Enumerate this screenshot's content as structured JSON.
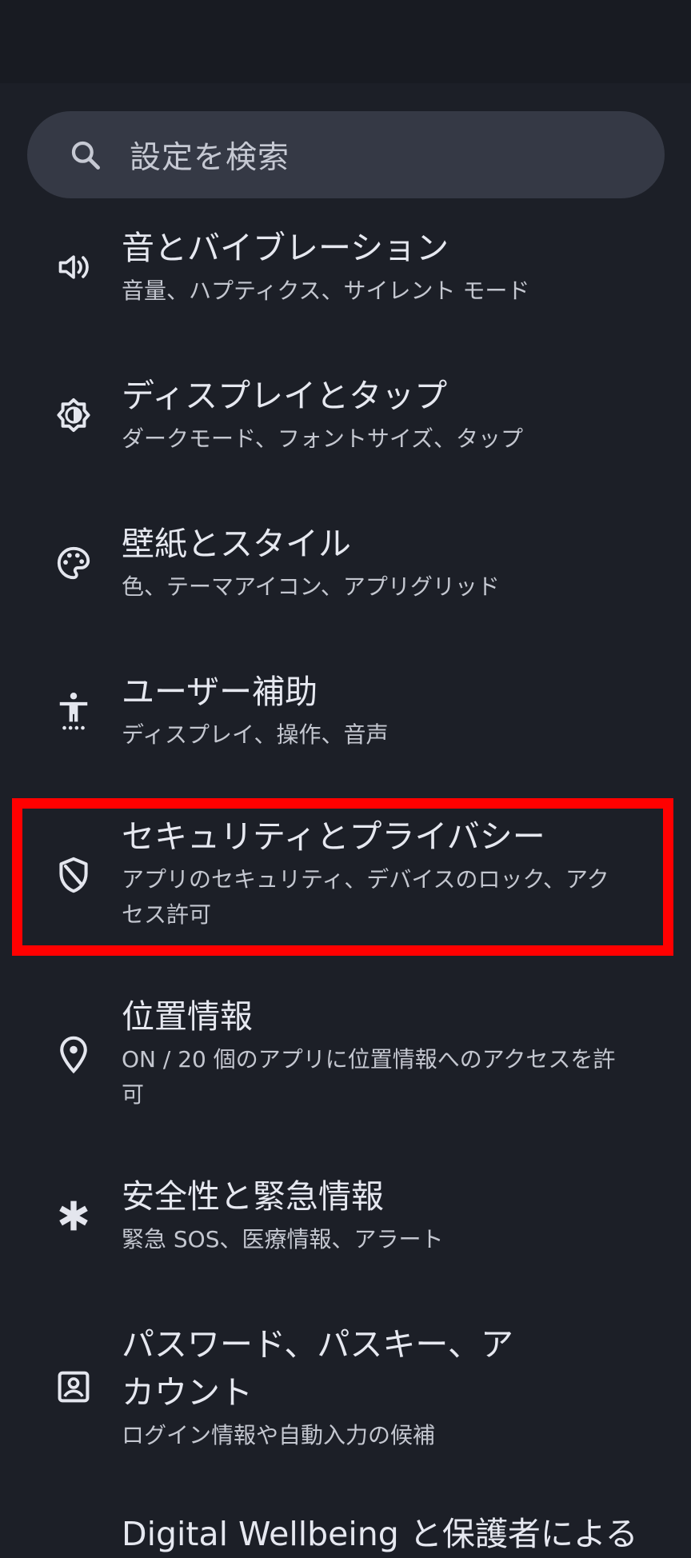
{
  "search": {
    "placeholder": "設定を検索",
    "icon": "search-icon"
  },
  "items": [
    {
      "title": "音とバイブレーション",
      "summary": "音量、ハプティクス、サイレント モード",
      "icon": "volume-icon"
    },
    {
      "title": "ディスプレイとタップ",
      "summary": "ダークモード、フォントサイズ、タップ",
      "icon": "brightness-icon"
    },
    {
      "title": "壁紙とスタイル",
      "summary": "色、テーマアイコン、アプリグリッド",
      "icon": "palette-icon"
    },
    {
      "title": "ユーザー補助",
      "summary": "ディスプレイ、操作、音声",
      "icon": "accessibility-icon"
    },
    {
      "title": "セキュリティとプライバシー",
      "summary": "アプリのセキュリティ、デバイスのロック、アクセス許可",
      "icon": "shield-icon"
    },
    {
      "title": "位置情報",
      "summary": "ON / 20 個のアプリに位置情報へのアクセスを許可",
      "icon": "location-pin-icon"
    },
    {
      "title": "安全性と緊急情報",
      "summary": "緊急 SOS、医療情報、アラート",
      "icon": "asterisk-icon"
    },
    {
      "title": "パスワード、パスキー、アカウント",
      "summary": "ログイン情報や自動入力の候補",
      "icon": "account-box-icon"
    },
    {
      "title": "Digital Wellbeing と保護者による",
      "summary": "",
      "icon": ""
    }
  ],
  "colors": {
    "background": "#1c1f27",
    "search_background": "#353945",
    "highlight": "#ff0000"
  }
}
